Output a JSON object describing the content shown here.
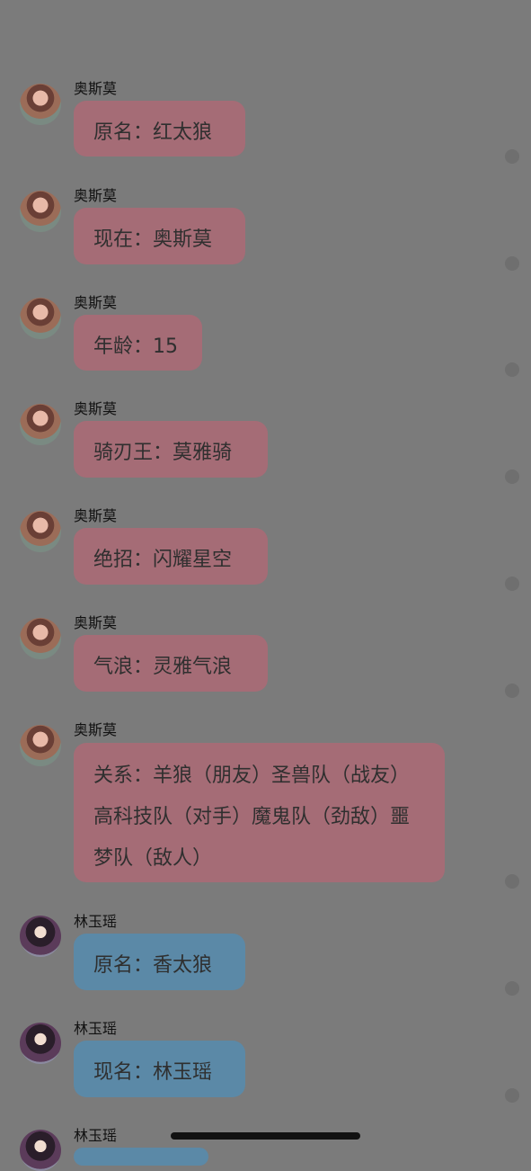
{
  "messages": [
    {
      "sender": "奥斯莫",
      "text": "原名：红太狼",
      "style": "pink"
    },
    {
      "sender": "奥斯莫",
      "text": "现在：奥斯莫",
      "style": "pink"
    },
    {
      "sender": "奥斯莫",
      "text": "年龄：15",
      "style": "pink"
    },
    {
      "sender": "奥斯莫",
      "text": "骑刃王：莫雅骑",
      "style": "pink"
    },
    {
      "sender": "奥斯莫",
      "text": "绝招：闪耀星空",
      "style": "pink"
    },
    {
      "sender": "奥斯莫",
      "text": "气浪：灵雅气浪",
      "style": "pink"
    },
    {
      "sender": "奥斯莫",
      "text": "关系：羊狼（朋友）圣兽队（战友）高科技队（对手）魔鬼队（劲敌）噩梦队（敌人）",
      "style": "pink"
    },
    {
      "sender": "林玉瑶",
      "text": "原名：香太狼",
      "style": "blue"
    },
    {
      "sender": "林玉瑶",
      "text": "现名：林玉瑶",
      "style": "blue"
    },
    {
      "sender": "林玉瑶",
      "text": "",
      "style": "blue"
    }
  ]
}
